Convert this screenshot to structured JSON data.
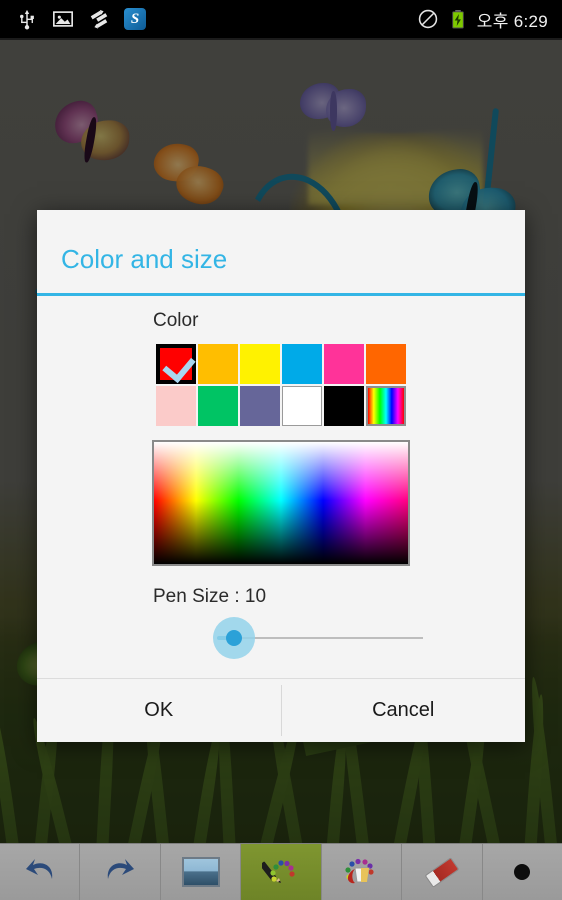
{
  "status_bar": {
    "left_icons": [
      {
        "name": "usb-icon",
        "glyph": "Ψ"
      },
      {
        "name": "gallery-image-icon",
        "glyph": "▣"
      },
      {
        "name": "data-transfer-icon",
        "glyph": "⇅"
      },
      {
        "name": "skype-app-icon",
        "glyph": "S"
      }
    ],
    "right_icons": [
      {
        "name": "silent-mode-icon",
        "glyph": "⃠"
      },
      {
        "name": "battery-charging-icon",
        "glyph": "⚡"
      }
    ],
    "clock": "오후 6:29"
  },
  "dialog": {
    "title": "Color and size",
    "color_section_label": "Color",
    "swatch_rows": [
      [
        {
          "name": "swatch-red",
          "color": "#FF0000",
          "selected": true
        },
        {
          "name": "swatch-amber",
          "color": "#FFBE00",
          "selected": false
        },
        {
          "name": "swatch-yellow",
          "color": "#FFF200",
          "selected": false
        },
        {
          "name": "swatch-sky-blue",
          "color": "#00AAE8",
          "selected": false
        },
        {
          "name": "swatch-pink",
          "color": "#FF3399",
          "selected": false
        },
        {
          "name": "swatch-orange",
          "color": "#FF6600",
          "selected": false
        }
      ],
      [
        {
          "name": "swatch-light-pink",
          "color": "#FBCBC9",
          "selected": false
        },
        {
          "name": "swatch-green",
          "color": "#00C464",
          "selected": false
        },
        {
          "name": "swatch-slate-purple",
          "color": "#666699",
          "selected": false
        },
        {
          "name": "swatch-white",
          "color": "#FFFFFF",
          "selected": false
        },
        {
          "name": "swatch-black",
          "color": "#000000",
          "selected": false
        },
        {
          "name": "swatch-rainbow",
          "color": "rainbow",
          "selected": false
        }
      ]
    ],
    "pen_size_label": "Pen Size : 10",
    "pen_size_value": 10,
    "ok_label": "OK",
    "cancel_label": "Cancel",
    "accent_color": "#33B5E5"
  },
  "toolbar": {
    "items": [
      {
        "name": "undo-button",
        "label": "Undo",
        "active": false
      },
      {
        "name": "redo-button",
        "label": "Redo",
        "active": false
      },
      {
        "name": "image-button",
        "label": "Image",
        "active": false
      },
      {
        "name": "pen-button",
        "label": "Pen",
        "active": true
      },
      {
        "name": "fill-button",
        "label": "Fill",
        "active": false
      },
      {
        "name": "eraser-button",
        "label": "Eraser",
        "active": false
      },
      {
        "name": "brush-size-button",
        "label": "Brush size",
        "active": false
      }
    ]
  }
}
